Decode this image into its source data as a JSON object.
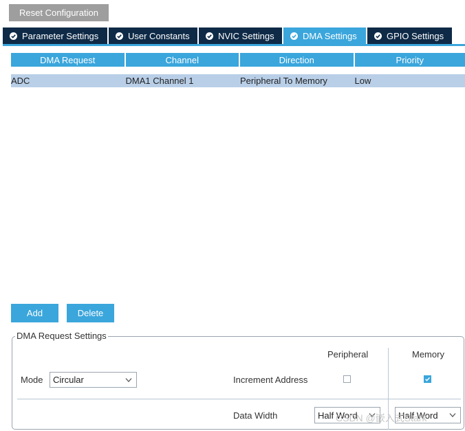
{
  "toolbar": {
    "reset_label": "Reset Configuration"
  },
  "tabs": [
    {
      "label": "Parameter Settings",
      "active": false
    },
    {
      "label": "User Constants",
      "active": false
    },
    {
      "label": "NVIC Settings",
      "active": false
    },
    {
      "label": "DMA Settings",
      "active": true
    },
    {
      "label": "GPIO Settings",
      "active": false
    }
  ],
  "table": {
    "columns": [
      "DMA Request",
      "Channel",
      "Direction",
      "Priority"
    ],
    "rows": [
      [
        "ADC",
        "DMA1 Channel 1",
        "Peripheral To Memory",
        "Low"
      ]
    ]
  },
  "actions": {
    "add_label": "Add",
    "delete_label": "Delete"
  },
  "settings": {
    "group_title": "DMA Request Settings",
    "peripheral_header": "Peripheral",
    "memory_header": "Memory",
    "mode_label": "Mode",
    "mode_value": "Circular",
    "increment_label": "Increment Address",
    "increment_peripheral": false,
    "increment_memory": true,
    "data_width_label": "Data Width",
    "peripheral_width": "Half Word",
    "memory_width": "Half Word"
  },
  "watermark": "CSDN @嵌入式Stark",
  "colors": {
    "accent": "#3aa6dc",
    "tab_dark": "#0e2a47",
    "row_selected": "#b9cfe8",
    "reset_gray": "#9e9e9e"
  }
}
